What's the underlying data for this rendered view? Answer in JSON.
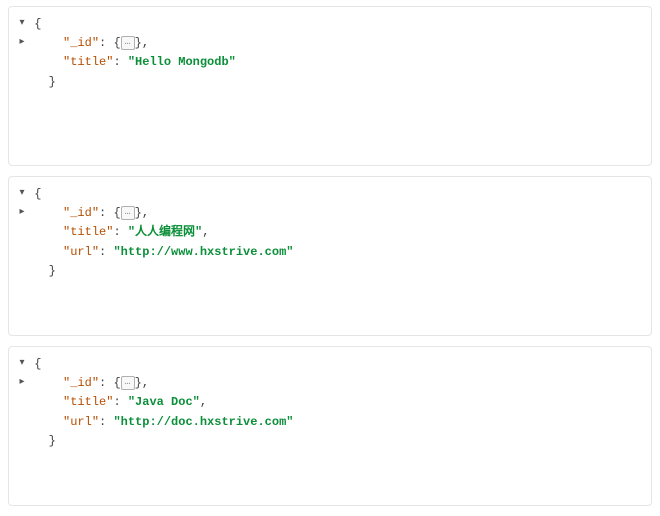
{
  "documents": [
    {
      "fields": [
        {
          "key": "\"_id\"",
          "type": "collapsed",
          "collapsedLabel": "…",
          "trailingComma": true
        },
        {
          "key": "\"title\"",
          "type": "string",
          "value": "\"Hello Mongodb\"",
          "trailingComma": false
        }
      ]
    },
    {
      "fields": [
        {
          "key": "\"_id\"",
          "type": "collapsed",
          "collapsedLabel": "…",
          "trailingComma": true
        },
        {
          "key": "\"title\"",
          "type": "string",
          "value": "\"人人编程网\"",
          "trailingComma": true
        },
        {
          "key": "\"url\"",
          "type": "string",
          "value": "\"http://www.hxstrive.com\"",
          "trailingComma": false
        }
      ]
    },
    {
      "fields": [
        {
          "key": "\"_id\"",
          "type": "collapsed",
          "collapsedLabel": "…",
          "trailingComma": true
        },
        {
          "key": "\"title\"",
          "type": "string",
          "value": "\"Java Doc\"",
          "trailingComma": true
        },
        {
          "key": "\"url\"",
          "type": "string",
          "value": "\"http://doc.hxstrive.com\"",
          "trailingComma": false
        }
      ]
    }
  ],
  "glyphs": {
    "down": "▾",
    "right": "▸",
    "braceOpen": "{",
    "braceClose": "}",
    "colon": ":",
    "comma": ","
  }
}
